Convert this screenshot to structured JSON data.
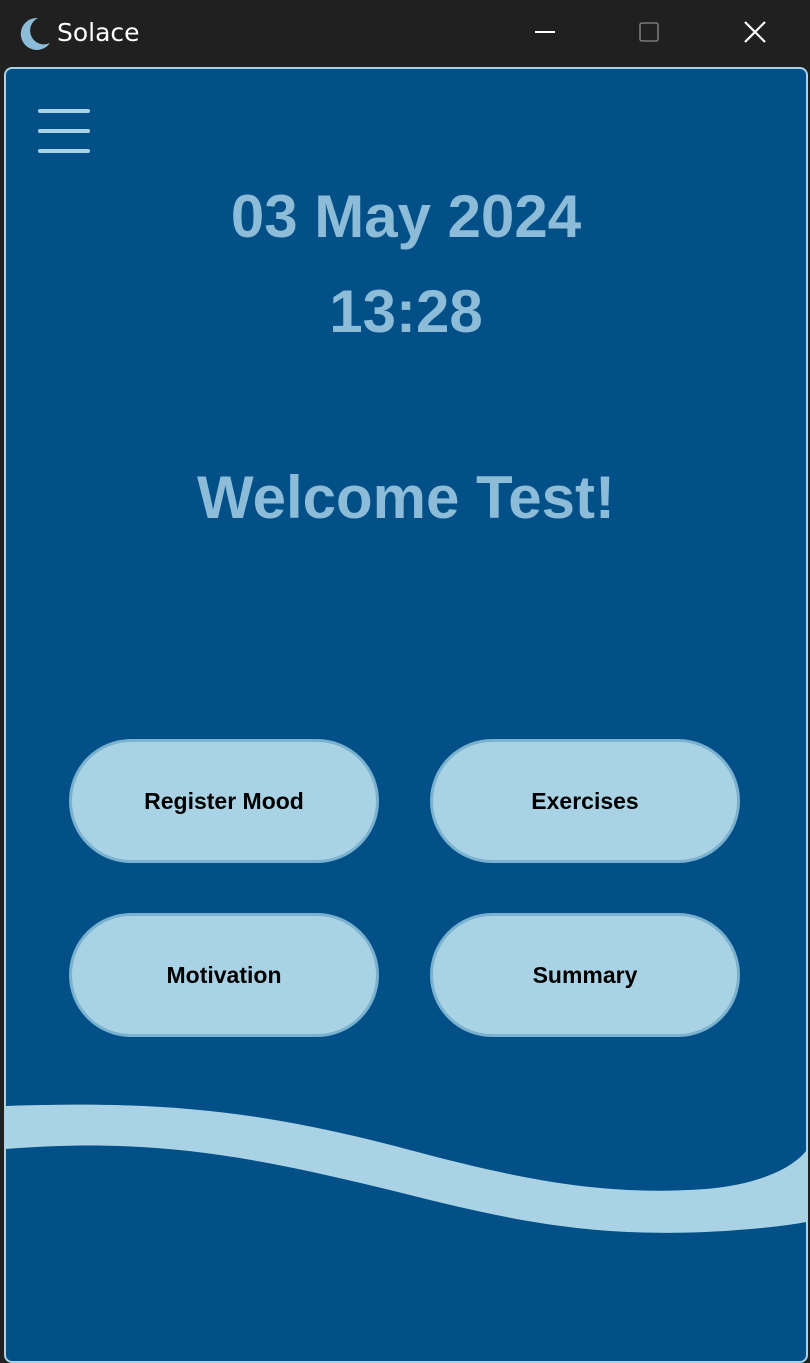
{
  "window": {
    "title": "Solace",
    "icon": "crescent-moon-icon"
  },
  "colors": {
    "background": "#034f87",
    "accent": "#a9d3e5",
    "text_light": "#8cbcd8",
    "button_text": "#000000"
  },
  "header": {
    "date": "03 May 2024",
    "time": "13:28"
  },
  "greeting": "Welcome Test!",
  "buttons": {
    "register_mood": "Register Mood",
    "exercises": "Exercises",
    "motivation": "Motivation",
    "summary": "Summary"
  }
}
